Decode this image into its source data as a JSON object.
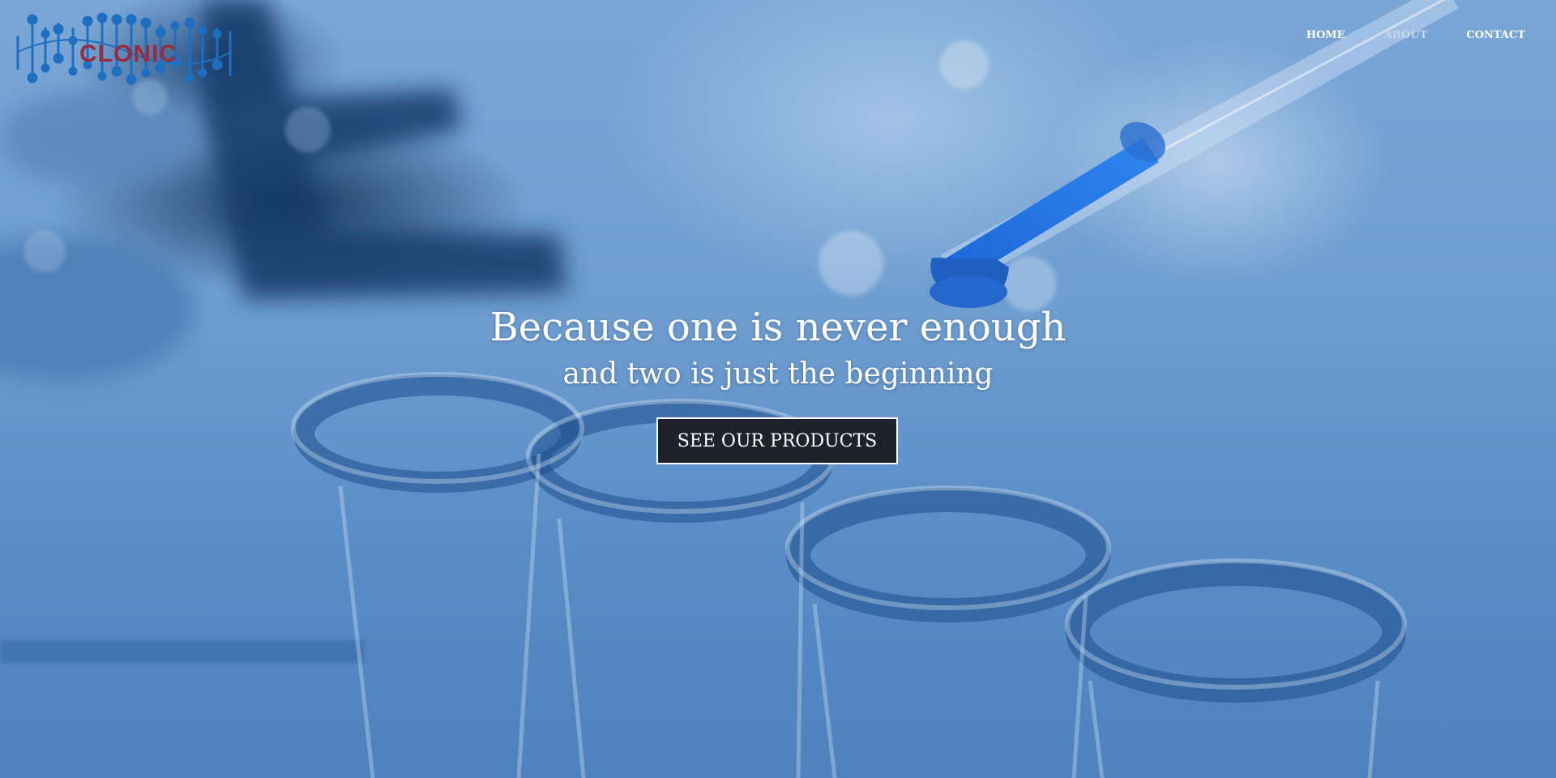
{
  "brand": {
    "logo_text": "CLONIC",
    "logo_text_color": "#9b2a3a",
    "logo_graphic_color": "#1f6fc0"
  },
  "nav": {
    "items": [
      {
        "label": "HOME",
        "active": true
      },
      {
        "label": "ABOUT",
        "active": false
      },
      {
        "label": "CONTACT",
        "active": false
      }
    ]
  },
  "hero": {
    "headline": "Because one is never enough",
    "subheadline": "and two is just the beginning",
    "cta_label": "SEE OUR PRODUCTS",
    "background_image": "blue-tinted laboratory photo: pipette dripping blue liquid over four glass test tubes"
  },
  "colors": {
    "cta_background": "#1c232b",
    "cta_border": "#ffffff",
    "text": "#ffffff",
    "nav_muted": "#c7d6ea"
  }
}
